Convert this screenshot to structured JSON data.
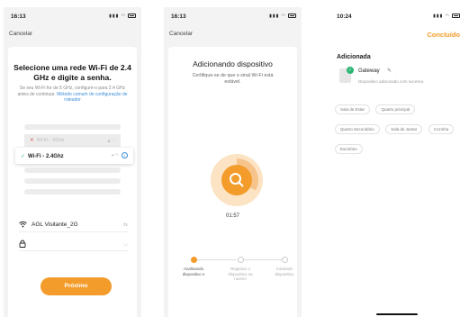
{
  "screens": [
    {
      "status_time": "16:13",
      "cancel": "Cancelar",
      "title": "Selecione uma rede Wi-Fi de 2.4 GHz e digite a senha.",
      "subtitle": "Se seu Wi-Fi for de 5 GHz, configure-o para 2.4 GHz antes de continuar.",
      "subtitle_link": "Método comum de configuração de roteador",
      "wifi_5g": "Wi-Fi - 5Ghz",
      "wifi_24g": "Wi-Fi - 2.4Ghz",
      "network_name": "AGL Visitante_2G",
      "next_button": "Próximo"
    },
    {
      "status_time": "16:13",
      "cancel": "Cancelar",
      "title": "Adicionando dispositivo",
      "subtitle": "Certifique-se de que o sinal Wi-Fi está estável.",
      "timer": "01:57",
      "steps": [
        "Analisando dispositivo s",
        "Registrar o dispositivo na nuvem",
        "Iniciando dispositivo"
      ],
      "progress_fraction": 0.33
    },
    {
      "status_time": "10:24",
      "done": "Concluído",
      "section_title": "Adicionada",
      "device_name": "Gateway",
      "device_message": "Dispositivo adicionado com sucesso.",
      "rooms": [
        "Sala de Estar",
        "Quarto principal",
        "Quarto Secundário",
        "Sala de Jantar",
        "Cozinha",
        "Escritório"
      ]
    }
  ],
  "colors": {
    "accent": "#f39c2b",
    "success": "#2bb673",
    "link": "#3b8dd8"
  },
  "icons": [
    "wifi-icon",
    "lock-icon",
    "search-icon",
    "check-icon",
    "close-icon",
    "info-icon",
    "edit-icon",
    "eye-off-icon",
    "battery-icon",
    "signal-icon"
  ]
}
